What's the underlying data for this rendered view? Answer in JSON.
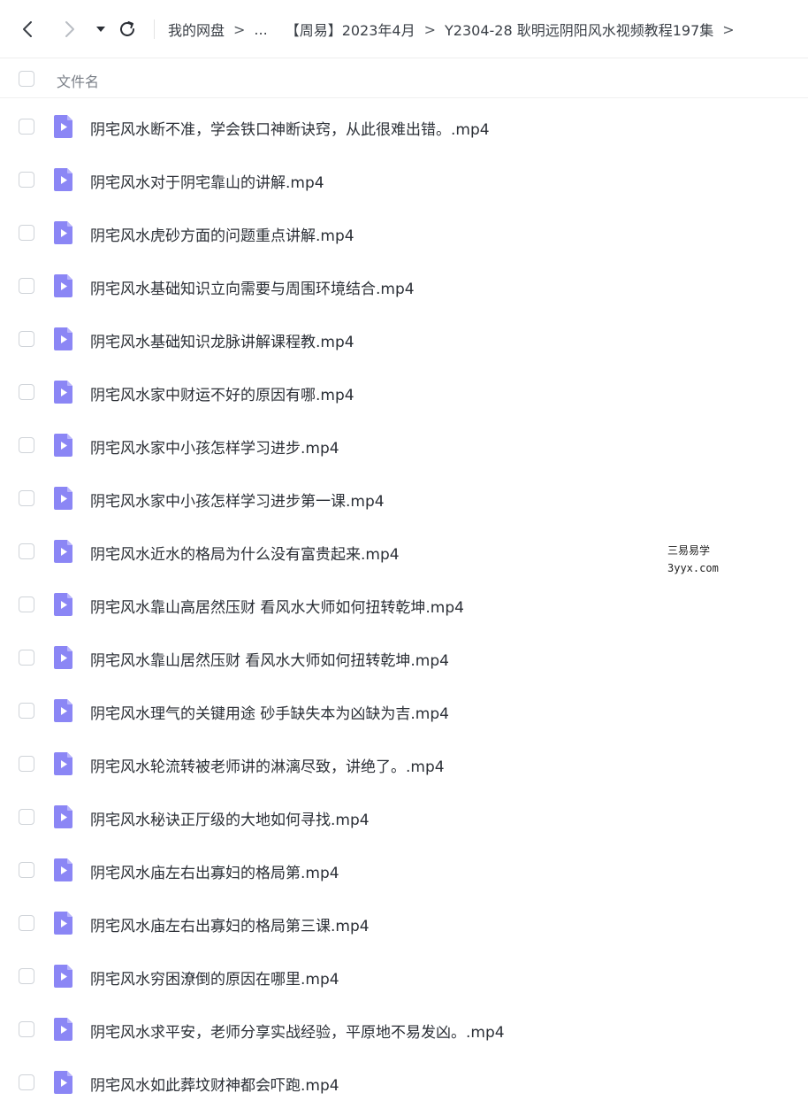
{
  "breadcrumb": [
    "我的网盘",
    "...",
    "【周易】2023年4月",
    "Y2304-28 耿明远阴阳风水视频教程197集"
  ],
  "breadcrumb_separator": ">",
  "list_header": {
    "column_name": "文件名"
  },
  "files": [
    "阴宅风水断不准，学会铁口神断诀窍，从此很难出错。.mp4",
    "阴宅风水对于阴宅靠山的讲解.mp4",
    "阴宅风水虎砂方面的问题重点讲解.mp4",
    "阴宅风水基础知识立向需要与周围环境结合.mp4",
    "阴宅风水基础知识龙脉讲解课程教.mp4",
    "阴宅风水家中财运不好的原因有哪.mp4",
    "阴宅风水家中小孩怎样学习进步.mp4",
    "阴宅风水家中小孩怎样学习进步第一课.mp4",
    "阴宅风水近水的格局为什么没有富贵起来.mp4",
    "阴宅风水靠山高居然压财 看风水大师如何扭转乾坤.mp4",
    "阴宅风水靠山居然压财 看风水大师如何扭转乾坤.mp4",
    "阴宅风水理气的关键用途 砂手缺失本为凶缺为吉.mp4",
    "阴宅风水轮流转被老师讲的淋漓尽致，讲绝了。.mp4",
    "阴宅风水秘诀正厅级的大地如何寻找.mp4",
    "阴宅风水庙左右出寡妇的格局第.mp4",
    "阴宅风水庙左右出寡妇的格局第三课.mp4",
    "阴宅风水穷困潦倒的原因在哪里.mp4",
    "阴宅风水求平安，老师分享实战经验，平原地不易发凶。.mp4",
    "阴宅风水如此葬坟财神都会吓跑.mp4"
  ],
  "watermark": {
    "line1": "三易易学",
    "line2": "3yyx.com"
  },
  "colors": {
    "file_icon": "#8b86f5",
    "file_icon_play": "#ffffff",
    "checkbox_border": "#cfd3d8",
    "text": "#2b2f36"
  },
  "icons": {
    "back": "chevron-left-icon",
    "forward": "chevron-right-icon",
    "dropdown": "caret-down-icon",
    "refresh": "refresh-icon",
    "file": "video-file-icon"
  }
}
